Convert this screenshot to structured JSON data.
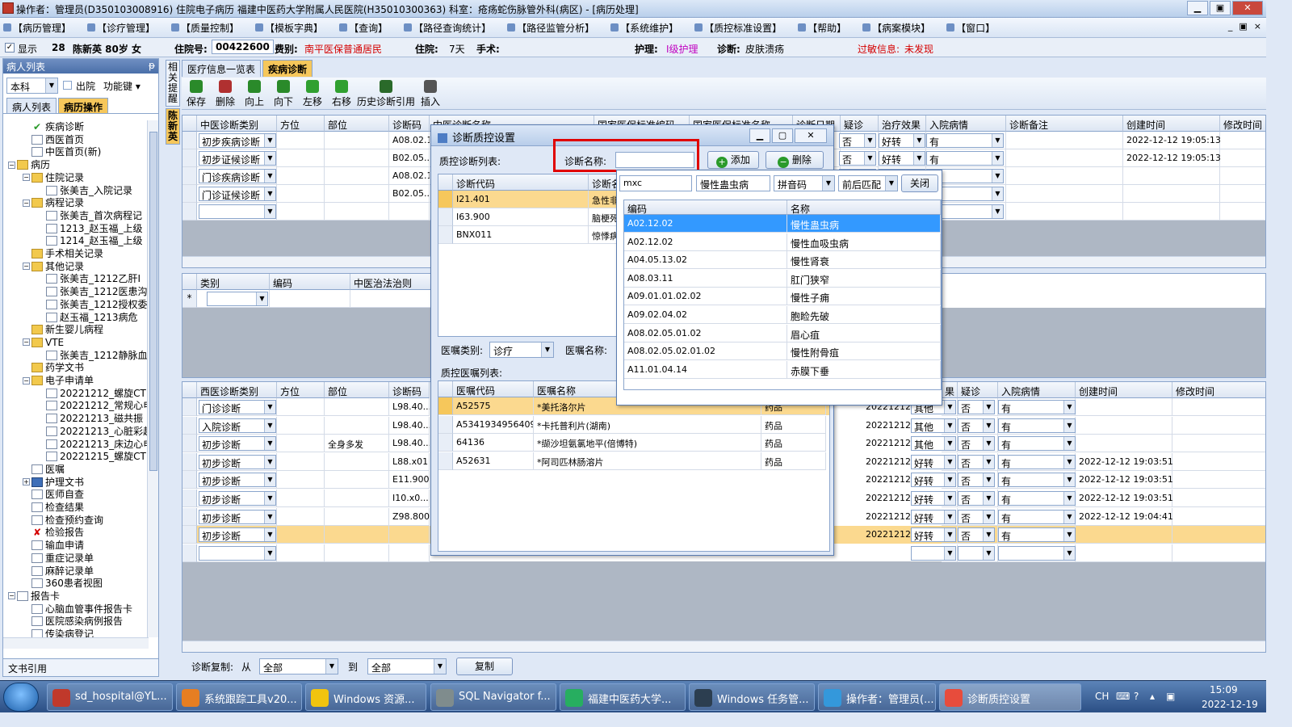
{
  "window": {
    "title": "操作者：管理员(D350103008916) 住院电子病历  福建中医药大学附属人民医院(H35010300363)  科室：疮疡蛇伤脉管外科(病区) - [病历处理]"
  },
  "menu": [
    "【病历管理】",
    "【诊疗管理】",
    "【质量控制】",
    "【模板字典】",
    "【查询】",
    "【路径查询统计】",
    "【路径监管分析】",
    "【系统维护】",
    "【质控标准设置】",
    "【帮助】",
    "【病案模块】",
    "【窗口】"
  ],
  "mdi_controls": [
    "_",
    "▣",
    "×"
  ],
  "patient": {
    "show_label": "显示",
    "bed": "28",
    "name_age": "陈新英 80岁 女",
    "inpatient_no_label": "住院号:",
    "inpatient_no": "00422600",
    "fee_label": "费别:",
    "fee": "南平医保普通居民",
    "stay_label": "住院:",
    "stay": "7天",
    "surgery_label": "手术:",
    "nursing_label": "护理:",
    "nursing": "I级护理",
    "diag_label": "诊断:",
    "diag": "皮肤溃疡",
    "allergy_label": "过敏信息:",
    "allergy": "未发现"
  },
  "left": {
    "header": "病人列表",
    "pin": "ᵽ",
    "dept_select": "本科",
    "discharged_label": "出院",
    "func_key": "功能键 ▾",
    "tabs": [
      "病人列表",
      "病历操作"
    ],
    "footer": "文书引用",
    "tree": [
      {
        "t": "疾病诊断",
        "d": 1,
        "ic": "chk"
      },
      {
        "t": "西医首页",
        "d": 1,
        "ic": "doc"
      },
      {
        "t": "中医首页(新)",
        "d": 1,
        "ic": "doc"
      },
      {
        "t": "病历",
        "d": 0,
        "ic": "fold",
        "exp": "−"
      },
      {
        "t": "住院记录",
        "d": 1,
        "ic": "fold",
        "exp": "−"
      },
      {
        "t": "张美吉_入院记录",
        "d": 2,
        "ic": "doc"
      },
      {
        "t": "病程记录",
        "d": 1,
        "ic": "fold",
        "exp": "−"
      },
      {
        "t": "张美吉_首次病程记",
        "d": 2,
        "ic": "doc"
      },
      {
        "t": "1213_赵玉福_上级",
        "d": 2,
        "ic": "doc"
      },
      {
        "t": "1214_赵玉福_上级",
        "d": 2,
        "ic": "doc"
      },
      {
        "t": "手术相关记录",
        "d": 1,
        "ic": "fold"
      },
      {
        "t": "其他记录",
        "d": 1,
        "ic": "fold",
        "exp": "−"
      },
      {
        "t": "张美吉_1212乙肝I",
        "d": 2,
        "ic": "doc"
      },
      {
        "t": "张美吉_1212医患沟",
        "d": 2,
        "ic": "doc"
      },
      {
        "t": "张美吉_1212授权委",
        "d": 2,
        "ic": "doc"
      },
      {
        "t": "赵玉福_1213病危",
        "d": 2,
        "ic": "doc"
      },
      {
        "t": "新生婴儿病程",
        "d": 1,
        "ic": "fold"
      },
      {
        "t": "VTE",
        "d": 1,
        "ic": "fold",
        "exp": "−"
      },
      {
        "t": "张美吉_1212静脉血",
        "d": 2,
        "ic": "doc"
      },
      {
        "t": "药学文书",
        "d": 1,
        "ic": "fold"
      },
      {
        "t": "电子申请单",
        "d": 1,
        "ic": "fold",
        "exp": "−"
      },
      {
        "t": "20221212_螺旋CT",
        "d": 2,
        "ic": "doc"
      },
      {
        "t": "20221212_常规心电",
        "d": 2,
        "ic": "doc"
      },
      {
        "t": "20221213_磁共振",
        "d": 2,
        "ic": "doc"
      },
      {
        "t": "20221213_心脏彩超",
        "d": 2,
        "ic": "doc"
      },
      {
        "t": "20221213_床边心电",
        "d": 2,
        "ic": "doc"
      },
      {
        "t": "20221215_螺旋CT",
        "d": 2,
        "ic": "doc"
      },
      {
        "t": "医嘱",
        "d": 1,
        "ic": "doc"
      },
      {
        "t": "护理文书",
        "d": 1,
        "ic": "book",
        "exp": "+"
      },
      {
        "t": "医师自查",
        "d": 1,
        "ic": "doc"
      },
      {
        "t": "检查结果",
        "d": 1,
        "ic": "doc"
      },
      {
        "t": "检查预约查询",
        "d": 1,
        "ic": "doc"
      },
      {
        "t": "检验报告",
        "d": 1,
        "ic": "xx"
      },
      {
        "t": "输血申请",
        "d": 1,
        "ic": "doc"
      },
      {
        "t": "重症记录单",
        "d": 1,
        "ic": "doc"
      },
      {
        "t": "麻醉记录单",
        "d": 1,
        "ic": "doc"
      },
      {
        "t": "360患者视图",
        "d": 1,
        "ic": "doc"
      },
      {
        "t": "报告卡",
        "d": 0,
        "ic": "doc",
        "exp": "−"
      },
      {
        "t": "心脑血管事件报告卡",
        "d": 1,
        "ic": "doc"
      },
      {
        "t": "医院感染病例报告",
        "d": 1,
        "ic": "doc"
      },
      {
        "t": "传染病登记",
        "d": 1,
        "ic": "doc"
      }
    ]
  },
  "vtabs": [
    "相关提醒",
    "陈新英"
  ],
  "main_tabs": [
    "医疗信息一览表",
    "疾病诊断"
  ],
  "toolbar": [
    "保存",
    "删除",
    "向上",
    "向下",
    "左移",
    "右移",
    "历史诊断引用",
    "插入"
  ],
  "tcm_grid": {
    "headers": [
      "中医诊断类别",
      "方位",
      "部位",
      "诊断码",
      "中医诊断名称",
      "国家医保标准编码",
      "国家医保标准名称",
      "诊断日期",
      "疑诊",
      "治疗效果",
      "入院病情",
      "诊断备注",
      "创建时间",
      "修改时间"
    ],
    "rows": [
      {
        "type": "初步疾病诊断",
        "code": "A08.02.14",
        "yz": "否",
        "eff": "好转",
        "adm": "有",
        "created": "2022-12-12 19:05:13"
      },
      {
        "type": "初步证候诊断",
        "code": "B02.05...",
        "yz": "否",
        "eff": "好转",
        "adm": "有",
        "created": "2022-12-12 19:05:13"
      },
      {
        "type": "门诊疾病诊断",
        "code": "A08.02.14",
        "yz": "",
        "eff": "",
        "adm": "",
        "created": ""
      },
      {
        "type": "门诊证候诊断",
        "code": "B02.05...",
        "yz": "",
        "eff": "",
        "adm": "",
        "created": ""
      },
      {
        "type": "",
        "code": "",
        "yz": "",
        "eff": "",
        "adm": "",
        "created": ""
      }
    ]
  },
  "tcm_method_grid": {
    "headers": [
      "类别",
      "编码",
      "中医治法治则"
    ],
    "new_row": "*"
  },
  "west_grid": {
    "headers": [
      "西医诊断类别",
      "方位",
      "部位",
      "诊断码",
      "果",
      "疑诊",
      "入院病情",
      "创建时间",
      "修改时间"
    ],
    "rows": [
      {
        "type": "门诊诊断",
        "pos": "",
        "code": "L98.40...",
        "date": "20221212",
        "eff": "其他",
        "yz": "否",
        "adm": "有",
        "created": ""
      },
      {
        "type": "入院诊断",
        "pos": "",
        "code": "L98.40...",
        "date": "20221212",
        "eff": "其他",
        "yz": "否",
        "adm": "有",
        "created": ""
      },
      {
        "type": "初步诊断",
        "pos": "全身多发",
        "code": "L98.40...",
        "date": "20221212",
        "eff": "其他",
        "yz": "否",
        "adm": "有",
        "created": ""
      },
      {
        "type": "初步诊断",
        "pos": "",
        "code": "L88.x01",
        "date": "20221212",
        "eff": "好转",
        "yz": "否",
        "adm": "有",
        "created": "2022-12-12 19:03:51"
      },
      {
        "type": "初步诊断",
        "pos": "",
        "code": "E11.900",
        "date": "20221212",
        "eff": "好转",
        "yz": "否",
        "adm": "有",
        "created": "2022-12-12 19:03:51"
      },
      {
        "type": "初步诊断",
        "pos": "",
        "code": "I10.x0...",
        "date": "20221212",
        "eff": "好转",
        "yz": "否",
        "adm": "有",
        "created": "2022-12-12 19:03:51"
      },
      {
        "type": "初步诊断",
        "pos": "",
        "code": "Z98.800",
        "date": "20221212",
        "eff": "好转",
        "yz": "否",
        "adm": "有",
        "created": "2022-12-12 19:04:41"
      },
      {
        "type": "初步诊断",
        "pos": "",
        "code": "",
        "date": "20221212",
        "eff": "好转",
        "yz": "否",
        "adm": "有",
        "created": ""
      },
      {
        "type": "",
        "pos": "",
        "code": "",
        "date": "",
        "eff": "",
        "yz": "",
        "adm": "",
        "created": ""
      }
    ]
  },
  "copy_bar": {
    "label": "诊断复制:",
    "from": "从",
    "from_val": "全部",
    "to": "到",
    "to_val": "全部",
    "btn": "复制"
  },
  "dialog": {
    "title": "诊断质控设置",
    "list_label": "质控诊断列表:",
    "name_label": "诊断名称:",
    "name_value": "",
    "add": "添加",
    "delete": "删除",
    "diag_headers": [
      "诊断代码",
      "诊断名"
    ],
    "diag_rows": [
      {
        "code": "I21.401",
        "name": "急性非"
      },
      {
        "code": "I63.900",
        "name": "脑梗死"
      },
      {
        "code": "BNX011",
        "name": "惊悸病"
      }
    ],
    "order_type_label": "医嘱类别:",
    "order_type": "诊疗",
    "order_name_label": "医嘱名称:",
    "order_list_label": "质控医嘱列表:",
    "order_headers": [
      "医嘱代码",
      "医嘱名称",
      ""
    ],
    "order_rows": [
      {
        "code": "A52575",
        "name": "*美托洛尔片",
        "kind": "药品"
      },
      {
        "code": "A53419349564096",
        "name": "*卡托普利片(湖南)",
        "kind": "药品"
      },
      {
        "code": "64136",
        "name": "*缬沙坦氨氯地平(倍博特)",
        "kind": "药品"
      },
      {
        "code": "A52631",
        "name": "*阿司匹林肠溶片",
        "kind": "药品"
      }
    ]
  },
  "popup": {
    "search": "mxc",
    "selected": "慢性蛊虫病",
    "mode": "拼音码",
    "match": "前后匹配",
    "close": "关闭",
    "headers": [
      "编码",
      "名称"
    ],
    "rows": [
      {
        "code": "A02.12.02",
        "name": "慢性蛊虫病"
      },
      {
        "code": "A02.12.02",
        "name": "慢性血吸虫病"
      },
      {
        "code": "A04.05.13.02",
        "name": "慢性肾衰"
      },
      {
        "code": "A08.03.11",
        "name": "肛门狭窄"
      },
      {
        "code": "A09.01.01.02.02",
        "name": "慢性子痈"
      },
      {
        "code": "A09.02.04.02",
        "name": "胞睑先破"
      },
      {
        "code": "A08.02.05.01.02",
        "name": "眉心疽"
      },
      {
        "code": "A08.02.05.02.01.02",
        "name": "慢性附骨疽"
      },
      {
        "code": "A11.01.04.14",
        "name": "赤膜下垂"
      }
    ]
  },
  "taskbar": {
    "items": [
      "sd_hospital@YL...",
      "系统跟踪工具v20...",
      "Windows 资源...",
      "SQL Navigator f...",
      "福建中医药大学...",
      "Windows 任务管...",
      "操作者：管理员(...",
      "诊断质控设置"
    ],
    "lang": "CH",
    "time": "15:09",
    "date": "2022-12-19"
  },
  "colors": {
    "accent": "#f6c75b",
    "highlight": "#3399ff",
    "select_row": "#fbd98f",
    "red_box": "#e00000"
  }
}
